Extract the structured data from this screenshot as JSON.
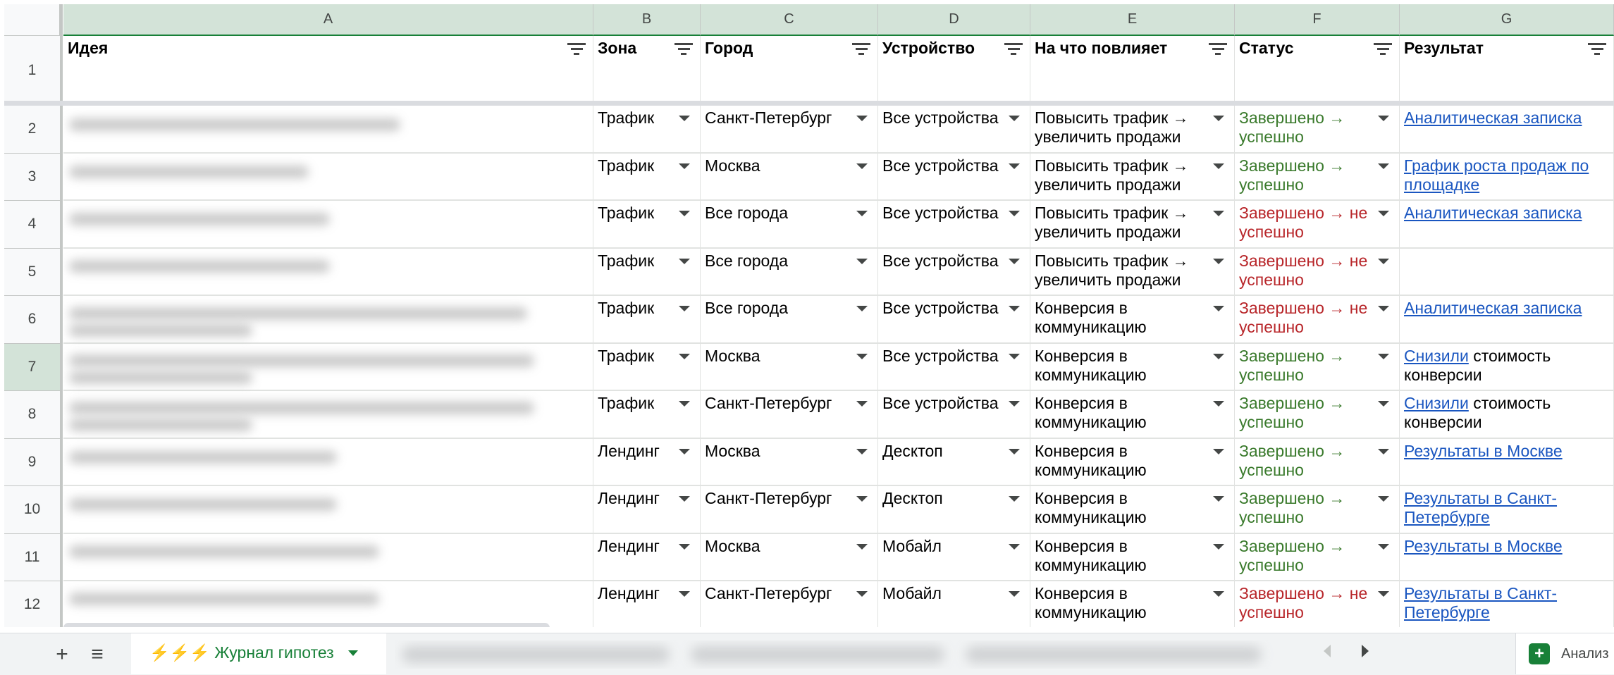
{
  "columns": [
    "A",
    "B",
    "C",
    "D",
    "E",
    "F",
    "G"
  ],
  "headers": [
    "Идея",
    "Зона",
    "Город",
    "Устройство",
    "На что повлияет",
    "Статус",
    "Результат"
  ],
  "row_numbers": [
    "1",
    "2",
    "3",
    "4",
    "5",
    "6",
    "7",
    "8",
    "9",
    "10",
    "11",
    "12"
  ],
  "rows": [
    {
      "zone": "Трафик",
      "city": "Санкт-Петербург",
      "device": "Все устройства",
      "impact": "Повысить трафик → увеличить продажи",
      "status": "Завершено → успешно",
      "status_kind": "success",
      "result": [
        {
          "text": "Аналитическая записка",
          "link": true
        }
      ]
    },
    {
      "zone": "Трафик",
      "city": "Москва",
      "device": "Все устройства",
      "impact": "Повысить трафик → увеличить продажи",
      "status": "Завершено → успешно",
      "status_kind": "success",
      "result": [
        {
          "text": "График роста продаж по площадке",
          "link": true
        }
      ]
    },
    {
      "zone": "Трафик",
      "city": "Все города",
      "device": "Все устройства",
      "impact": "Повысить трафик → увеличить продажи",
      "status": "Завершено → не успешно",
      "status_kind": "fail",
      "result": [
        {
          "text": "Аналитическая записка",
          "link": true
        }
      ]
    },
    {
      "zone": "Трафик",
      "city": "Все города",
      "device": "Все устройства",
      "impact": "Повысить трафик → увеличить продажи",
      "status": "Завершено → не успешно",
      "status_kind": "fail",
      "result": []
    },
    {
      "zone": "Трафик",
      "city": "Все города",
      "device": "Все устройства",
      "impact": "Конверсия в коммуникацию",
      "status": "Завершено → не успешно",
      "status_kind": "fail",
      "result": [
        {
          "text": "Аналитическая записка",
          "link": true
        }
      ]
    },
    {
      "zone": "Трафик",
      "city": "Москва",
      "device": "Все устройства",
      "impact": "Конверсия в коммуникацию",
      "status": "Завершено → успешно",
      "status_kind": "success",
      "result": [
        {
          "text": "Снизили",
          "link": true
        },
        {
          "text": " стоимость конверсии",
          "link": false
        }
      ]
    },
    {
      "zone": "Трафик",
      "city": "Санкт-Петербург",
      "device": "Все устройства",
      "impact": "Конверсия в коммуникацию",
      "status": "Завершено → успешно",
      "status_kind": "success",
      "result": [
        {
          "text": "Снизили",
          "link": true
        },
        {
          "text": " стоимость конверсии",
          "link": false
        }
      ]
    },
    {
      "zone": "Лендинг",
      "city": "Москва",
      "device": "Десктоп",
      "impact": "Конверсия в коммуникацию",
      "status": "Завершено → успешно",
      "status_kind": "success",
      "result": [
        {
          "text": "Результаты в Москве",
          "link": true
        }
      ]
    },
    {
      "zone": "Лендинг",
      "city": "Санкт-Петербург",
      "device": "Десктоп",
      "impact": "Конверсия в коммуникацию",
      "status": "Завершено → успешно",
      "status_kind": "success",
      "result": [
        {
          "text": "Результаты в Санкт-Петербурге",
          "link": true
        }
      ]
    },
    {
      "zone": "Лендинг",
      "city": "Москва",
      "device": "Мобайл",
      "impact": "Конверсия в коммуникацию",
      "status": "Завершено → успешно",
      "status_kind": "success",
      "result": [
        {
          "text": "Результаты в Москве",
          "link": true
        }
      ]
    },
    {
      "zone": "Лендинг",
      "city": "Санкт-Петербург",
      "device": "Мобайл",
      "impact": "Конверсия в коммуникацию",
      "status": "Завершено → не успешно",
      "status_kind": "fail",
      "result": [
        {
          "text": "Результаты в Санкт-Петербурге",
          "link": true
        }
      ]
    }
  ],
  "sheet_tab": {
    "label": "⚡⚡⚡ Журнал гипотез"
  },
  "tabbar": {
    "add_label": "+",
    "list_label": "≡",
    "explore_label": "Анализ"
  },
  "colors": {
    "success": "#3a7a2c",
    "fail": "#b8262a",
    "link": "#1a56c0",
    "accent": "#188038"
  }
}
